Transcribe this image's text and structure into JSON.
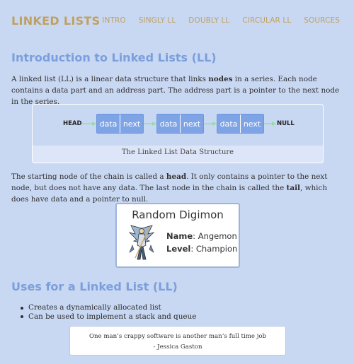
{
  "header": {
    "brand": "LINKED LISTS",
    "nav": [
      "INTRO",
      "SINGLY LL",
      "DOUBLY LL",
      "CIRCULAR LL",
      "SOURCES"
    ]
  },
  "intro": {
    "heading": "Introduction to Linked Lists (LL)",
    "p1_before": "A linked list (LL) is a linear data structure that links ",
    "p1_bold": "nodes",
    "p1_after": " in a series. Each node contains a data part and an address part. The address part is a pointer to the next node in the series.",
    "diagram": {
      "head_label": "HEAD",
      "null_label": "NULL",
      "nodes": [
        {
          "data": "data",
          "next": "next"
        },
        {
          "data": "data",
          "next": "next"
        },
        {
          "data": "data",
          "next": "next"
        }
      ],
      "caption": "The Linked List Data Structure"
    },
    "p2_a": "The starting node of the chain is called a ",
    "p2_head": "head",
    "p2_b": ". It only contains a pointer to the next node, but does not have any data. The last node in the chain is called the ",
    "p2_tail": "tail",
    "p2_c": ", which does have data and a pointer to null."
  },
  "digimon": {
    "title": "Random Digimon",
    "name_label": "Name",
    "name_value": ": Angemon",
    "level_label": "Level",
    "level_value": ": Champion"
  },
  "uses": {
    "heading": "Uses for a Linked List (LL)",
    "items": [
      "Creates a dynamically allocated list",
      "Can be used to implement a stack and queue"
    ]
  },
  "quote": {
    "text": "One man’s crappy software is another man’s full time job",
    "author": "- Jessica Gaston"
  },
  "colors": {
    "background": "#c9d8f2",
    "accent_gold": "#c0a060",
    "heading_blue": "#7a9fdc",
    "node_blue": "#7fa4e6",
    "arrow_green": "#8fe0a0"
  }
}
